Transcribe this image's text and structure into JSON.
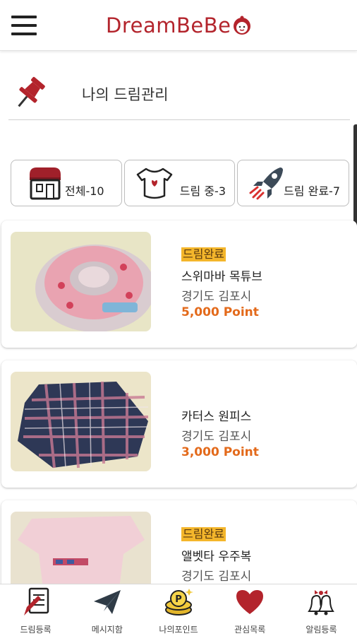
{
  "header": {
    "logo_text": "DreamBeBe",
    "brand_color": "#b3242c"
  },
  "section": {
    "title": "나의 드림관리",
    "icon": "pushpin-icon"
  },
  "filters": [
    {
      "label": "전체-10",
      "icon": "shop-icon"
    },
    {
      "label": "드림 중-3",
      "icon": "baby-onesie-icon"
    },
    {
      "label": "드림 완료-7",
      "icon": "rocket-icon"
    }
  ],
  "items": [
    {
      "badge": "드림완료",
      "name": "스위마바 목튜브",
      "location": "경기도 김포시",
      "points": "5,000 Point",
      "image": "pink-swim-neck-ring-photo"
    },
    {
      "badge": "",
      "name": "카터스 원피스",
      "location": "경기도 김포시",
      "points": "3,000 Point",
      "image": "plaid-dress-photo"
    },
    {
      "badge": "드림완료",
      "name": "앨벳타 우주복",
      "location": "경기도 김포시",
      "points": "",
      "image": "pink-bodysuit-photo"
    }
  ],
  "bottom_nav": [
    {
      "label": "드림등록",
      "icon": "register-note-icon"
    },
    {
      "label": "메시지함",
      "icon": "paper-plane-icon"
    },
    {
      "label": "나의포인트",
      "icon": "coin-points-icon"
    },
    {
      "label": "관심목록",
      "icon": "heart-icon"
    },
    {
      "label": "알림등록",
      "icon": "bell-icon"
    }
  ],
  "colors": {
    "badge_bg": "#f4b62b",
    "point_text": "#e36a1b",
    "accent_red": "#b3242c"
  }
}
